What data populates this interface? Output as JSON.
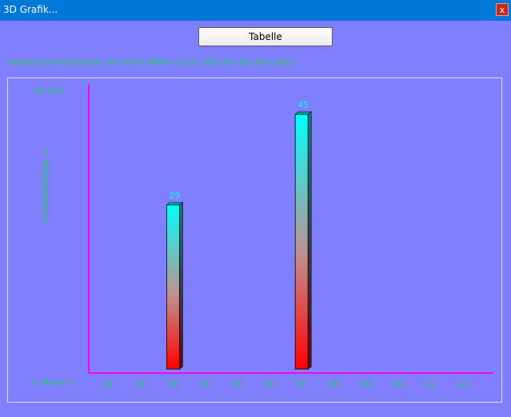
{
  "window": {
    "title": "3D Grafik...",
    "close_label": "x"
  },
  "toolbar": {
    "table_button": "Tabelle"
  },
  "subtitle": "Verbrauchsmitteleinsatz von Herrn Blöhm 21.07.2025 für das Jahr 2025",
  "chart_data": {
    "type": "bar",
    "title": "",
    "xlabel": "< Monat >",
    "ylabel": "< Einheitenfolge >",
    "y_max_label": "10.20 €",
    "categories": [
      "01",
      "02",
      "03",
      "04",
      "05",
      "06",
      "07",
      "08",
      "09",
      "10",
      "11",
      "12"
    ],
    "values": [
      null,
      null,
      29,
      null,
      null,
      null,
      45,
      null,
      null,
      null,
      null,
      null
    ],
    "ylim": [
      0,
      50
    ],
    "grid": false,
    "legend": "none"
  },
  "colors": {
    "background": "#7f7ffe",
    "axis": "#ff00ff",
    "text_green": "#16d24e",
    "label_cyan": "#00ffff",
    "bar_top": "#00ffff",
    "bar_bottom": "#ff0000",
    "titlebar": "#0078d7"
  }
}
